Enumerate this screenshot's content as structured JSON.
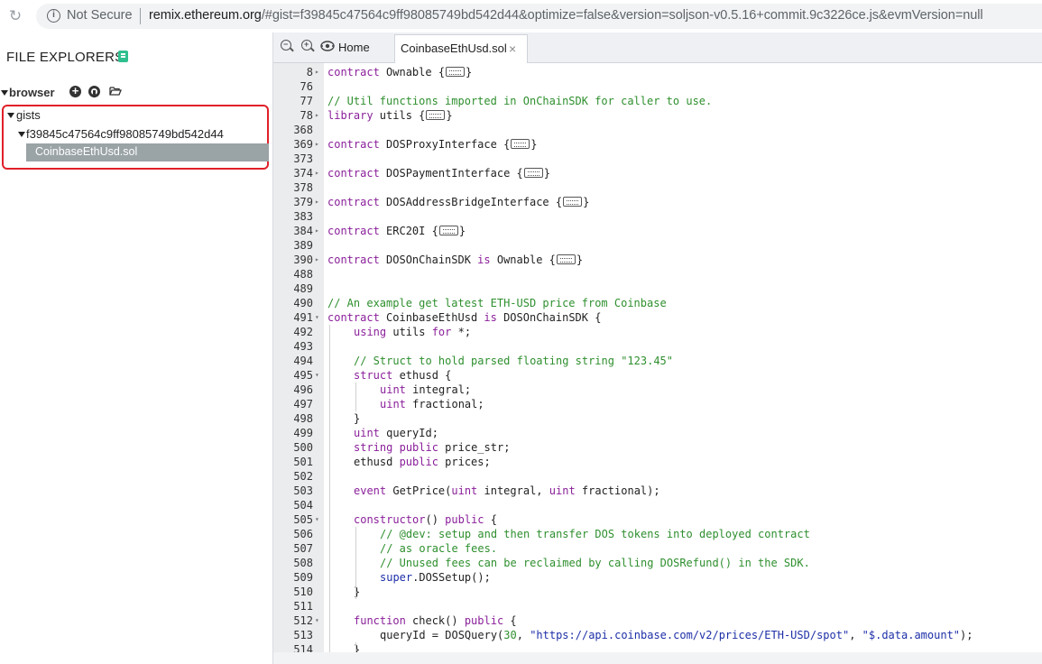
{
  "browser": {
    "security_label": "Not Secure",
    "url_host": "remix.ethereum.org",
    "url_rest": "/#gist=f39845c47564c9ff98085749bd542d44&optimize=false&version=soljson-v0.5.16+commit.9c3226ce.js&evmVersion=null"
  },
  "explorer": {
    "title": "FILE EXPLORERS",
    "root_label": "browser",
    "gists_label": "gists",
    "gist_id": "f39845c47564c9ff98085749bd542d44",
    "selected_file": "CoinbaseEthUsd.sol",
    "highlight_color": "#e0202a"
  },
  "tabs": {
    "home_label": "Home",
    "active_file_label": "CoinbaseEthUsd.sol",
    "close_glyph": "×"
  },
  "editor": {
    "lines": [
      {
        "n": "8",
        "fold": "▸",
        "indent": 0,
        "parts": [
          [
            "kw",
            "contract"
          ],
          [
            "t",
            " Ownable {"
          ],
          [
            "box",
            ""
          ],
          [
            "t",
            "}"
          ]
        ]
      },
      {
        "n": "76",
        "fold": "",
        "indent": 0,
        "parts": []
      },
      {
        "n": "77",
        "fold": "",
        "indent": 0,
        "parts": [
          [
            "cm",
            "// Util functions imported in OnChainSDK for caller to use."
          ]
        ]
      },
      {
        "n": "78",
        "fold": "▸",
        "indent": 0,
        "parts": [
          [
            "kw",
            "library"
          ],
          [
            "t",
            " utils {"
          ],
          [
            "box",
            ""
          ],
          [
            "t",
            "}"
          ]
        ]
      },
      {
        "n": "368",
        "fold": "",
        "indent": 0,
        "parts": []
      },
      {
        "n": "369",
        "fold": "▸",
        "indent": 0,
        "parts": [
          [
            "kw",
            "contract"
          ],
          [
            "t",
            " DOSProxyInterface {"
          ],
          [
            "box",
            ""
          ],
          [
            "t",
            "}"
          ]
        ]
      },
      {
        "n": "373",
        "fold": "",
        "indent": 0,
        "parts": []
      },
      {
        "n": "374",
        "fold": "▸",
        "indent": 0,
        "parts": [
          [
            "kw",
            "contract"
          ],
          [
            "t",
            " DOSPaymentInterface {"
          ],
          [
            "box",
            ""
          ],
          [
            "t",
            "}"
          ]
        ]
      },
      {
        "n": "378",
        "fold": "",
        "indent": 0,
        "parts": []
      },
      {
        "n": "379",
        "fold": "▸",
        "indent": 0,
        "parts": [
          [
            "kw",
            "contract"
          ],
          [
            "t",
            " DOSAddressBridgeInterface {"
          ],
          [
            "box",
            ""
          ],
          [
            "t",
            "}"
          ]
        ]
      },
      {
        "n": "383",
        "fold": "",
        "indent": 0,
        "parts": []
      },
      {
        "n": "384",
        "fold": "▸",
        "indent": 0,
        "parts": [
          [
            "kw",
            "contract"
          ],
          [
            "t",
            " ERC20I {"
          ],
          [
            "box",
            ""
          ],
          [
            "t",
            "}"
          ]
        ]
      },
      {
        "n": "389",
        "fold": "",
        "indent": 0,
        "parts": []
      },
      {
        "n": "390",
        "fold": "▸",
        "indent": 0,
        "parts": [
          [
            "kw",
            "contract"
          ],
          [
            "t",
            " DOSOnChainSDK "
          ],
          [
            "kw",
            "is"
          ],
          [
            "t",
            " Ownable {"
          ],
          [
            "box",
            ""
          ],
          [
            "t",
            "}"
          ]
        ]
      },
      {
        "n": "488",
        "fold": "",
        "indent": 0,
        "parts": []
      },
      {
        "n": "489",
        "fold": "",
        "indent": 0,
        "parts": []
      },
      {
        "n": "490",
        "fold": "",
        "indent": 0,
        "parts": [
          [
            "cm",
            "// An example get latest ETH-USD price from Coinbase"
          ]
        ]
      },
      {
        "n": "491",
        "fold": "▾",
        "indent": 0,
        "parts": [
          [
            "kw",
            "contract"
          ],
          [
            "t",
            " CoinbaseEthUsd "
          ],
          [
            "kw",
            "is"
          ],
          [
            "t",
            " DOSOnChainSDK {"
          ]
        ]
      },
      {
        "n": "492",
        "fold": "",
        "indent": 1,
        "parts": [
          [
            "kw",
            "using"
          ],
          [
            "t",
            " utils "
          ],
          [
            "kw",
            "for"
          ],
          [
            "t",
            " *;"
          ]
        ]
      },
      {
        "n": "493",
        "fold": "",
        "indent": 0,
        "parts": []
      },
      {
        "n": "494",
        "fold": "",
        "indent": 1,
        "parts": [
          [
            "cm",
            "// Struct to hold parsed floating string \"123.45\""
          ]
        ]
      },
      {
        "n": "495",
        "fold": "▾",
        "indent": 1,
        "parts": [
          [
            "kw",
            "struct"
          ],
          [
            "t",
            " ethusd {"
          ]
        ]
      },
      {
        "n": "496",
        "fold": "",
        "indent": 2,
        "parts": [
          [
            "kw",
            "uint"
          ],
          [
            "t",
            " integral;"
          ]
        ]
      },
      {
        "n": "497",
        "fold": "",
        "indent": 2,
        "parts": [
          [
            "kw",
            "uint"
          ],
          [
            "t",
            " fractional;"
          ]
        ]
      },
      {
        "n": "498",
        "fold": "",
        "indent": 1,
        "parts": [
          [
            "t",
            "}"
          ]
        ]
      },
      {
        "n": "499",
        "fold": "",
        "indent": 1,
        "parts": [
          [
            "kw",
            "uint"
          ],
          [
            "t",
            " queryId;"
          ]
        ]
      },
      {
        "n": "500",
        "fold": "",
        "indent": 1,
        "parts": [
          [
            "kw",
            "string"
          ],
          [
            "t",
            " "
          ],
          [
            "kw",
            "public"
          ],
          [
            "t",
            " price_str;"
          ]
        ]
      },
      {
        "n": "501",
        "fold": "",
        "indent": 1,
        "parts": [
          [
            "t",
            "ethusd "
          ],
          [
            "kw",
            "public"
          ],
          [
            "t",
            " prices;"
          ]
        ]
      },
      {
        "n": "502",
        "fold": "",
        "indent": 0,
        "parts": []
      },
      {
        "n": "503",
        "fold": "",
        "indent": 1,
        "parts": [
          [
            "kw",
            "event"
          ],
          [
            "t",
            " GetPrice("
          ],
          [
            "kw",
            "uint"
          ],
          [
            "t",
            " integral, "
          ],
          [
            "kw",
            "uint"
          ],
          [
            "t",
            " fractional);"
          ]
        ]
      },
      {
        "n": "504",
        "fold": "",
        "indent": 0,
        "parts": []
      },
      {
        "n": "505",
        "fold": "▾",
        "indent": 1,
        "parts": [
          [
            "kw",
            "constructor"
          ],
          [
            "t",
            "() "
          ],
          [
            "kw",
            "public"
          ],
          [
            "t",
            " {"
          ]
        ]
      },
      {
        "n": "506",
        "fold": "",
        "indent": 2,
        "parts": [
          [
            "cm",
            "// @dev: setup and then transfer DOS tokens into deployed contract"
          ]
        ]
      },
      {
        "n": "507",
        "fold": "",
        "indent": 2,
        "parts": [
          [
            "cm",
            "// as oracle fees."
          ]
        ]
      },
      {
        "n": "508",
        "fold": "",
        "indent": 2,
        "parts": [
          [
            "cm",
            "// Unused fees can be reclaimed by calling DOSRefund() in the SDK."
          ]
        ]
      },
      {
        "n": "509",
        "fold": "",
        "indent": 2,
        "parts": [
          [
            "st",
            "super"
          ],
          [
            "t",
            ".DOSSetup();"
          ]
        ]
      },
      {
        "n": "510",
        "fold": "",
        "indent": 1,
        "parts": [
          [
            "t",
            "}"
          ]
        ]
      },
      {
        "n": "511",
        "fold": "",
        "indent": 0,
        "parts": []
      },
      {
        "n": "512",
        "fold": "▾",
        "indent": 1,
        "parts": [
          [
            "kw",
            "function"
          ],
          [
            "t",
            " check() "
          ],
          [
            "kw",
            "public"
          ],
          [
            "t",
            " {"
          ]
        ]
      },
      {
        "n": "513",
        "fold": "",
        "indent": 2,
        "parts": [
          [
            "t",
            "queryId = DOSQuery("
          ],
          [
            "nm",
            "30"
          ],
          [
            "t",
            ", "
          ],
          [
            "st",
            "\"https://api.coinbase.com/v2/prices/ETH-USD/spot\""
          ],
          [
            "t",
            ", "
          ],
          [
            "st",
            "\"$.data.amount\""
          ],
          [
            "t",
            ");"
          ]
        ]
      },
      {
        "n": "514",
        "fold": "",
        "indent": 1,
        "parts": [
          [
            "t",
            "}"
          ]
        ]
      }
    ]
  }
}
